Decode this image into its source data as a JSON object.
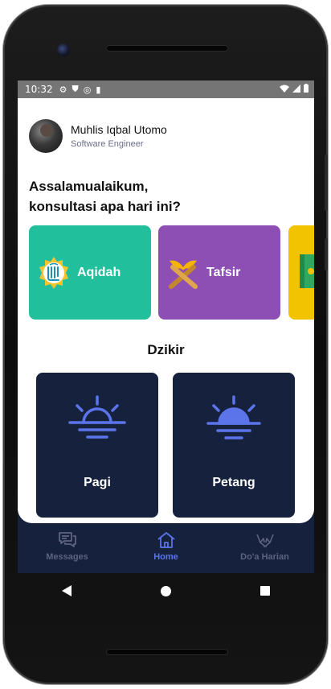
{
  "statusbar": {
    "time": "10:32"
  },
  "profile": {
    "name": "Muhlis Iqbal Utomo",
    "role": "Software Engineer"
  },
  "greeting": {
    "line1": "Assalamualaikum,",
    "line2": "konsultasi apa hari ini?"
  },
  "topics": [
    {
      "label": "Aqidah",
      "color": "#22bf9c",
      "icon": "allah-calligraphy-icon"
    },
    {
      "label": "Tafsir",
      "color": "#8e4fb5",
      "icon": "quran-stand-icon"
    },
    {
      "label": "",
      "color": "#f2c300",
      "icon": "book-icon"
    }
  ],
  "dzikir": {
    "title": "Dzikir",
    "items": [
      {
        "label": "Pagi",
        "icon": "sunrise-icon"
      },
      {
        "label": "Petang",
        "icon": "sunset-icon"
      }
    ]
  },
  "nav": {
    "items": [
      {
        "label": "Messages",
        "icon": "chat-icon",
        "active": false
      },
      {
        "label": "Home",
        "icon": "home-icon",
        "active": true
      },
      {
        "label": "Do'a Harian",
        "icon": "praying-hands-icon",
        "active": false
      }
    ],
    "active_color": "#5b74ea",
    "inactive_color": "#5d6380"
  },
  "colors": {
    "screen_bg": "#16213e",
    "accent": "#5b74ea"
  }
}
